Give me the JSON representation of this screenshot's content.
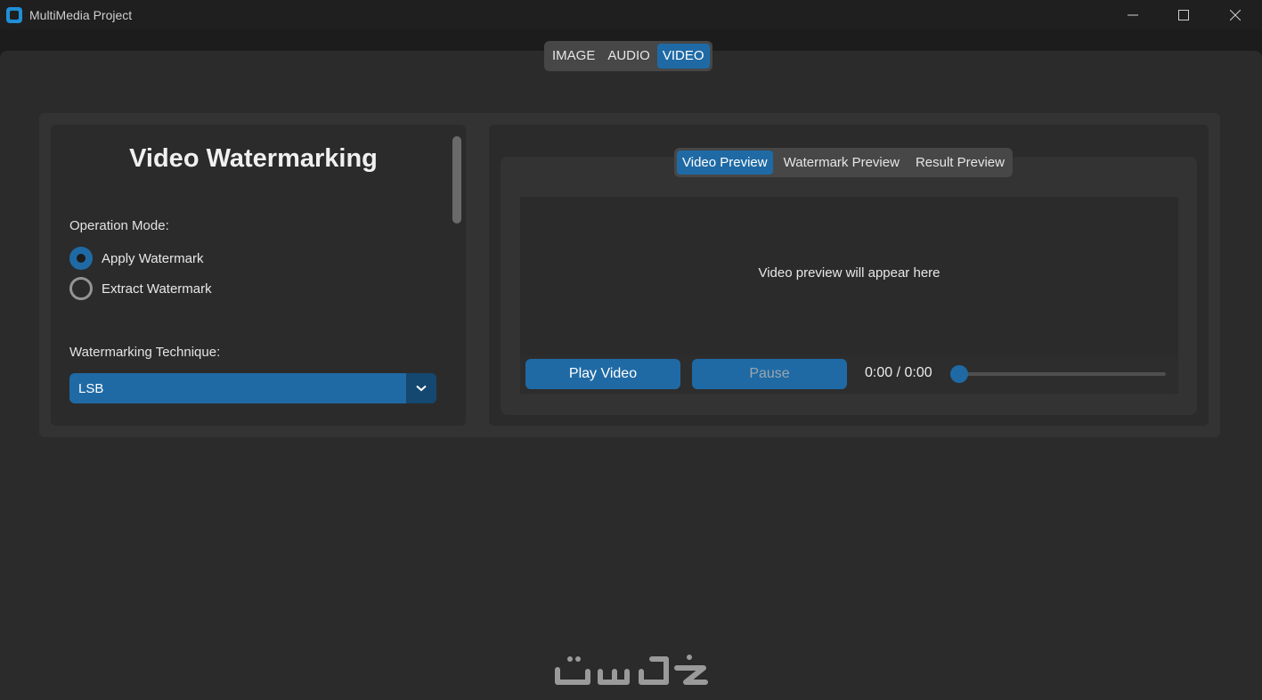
{
  "app": {
    "title": "MultiMedia Project"
  },
  "main_tabs": {
    "items": [
      {
        "label": "IMAGE",
        "active": false
      },
      {
        "label": "AUDIO",
        "active": false
      },
      {
        "label": "VIDEO",
        "active": true
      }
    ]
  },
  "left_panel": {
    "title": "Video Watermarking",
    "operation_mode_label": "Operation Mode:",
    "modes": [
      {
        "label": "Apply Watermark",
        "checked": true
      },
      {
        "label": "Extract Watermark",
        "checked": false
      }
    ],
    "technique_label": "Watermarking Technique:",
    "technique_value": "LSB"
  },
  "preview": {
    "tabs": [
      {
        "label": "Video Preview",
        "active": true
      },
      {
        "label": "Watermark Preview",
        "active": false
      },
      {
        "label": "Result Preview",
        "active": false
      }
    ],
    "placeholder": "Video preview will appear here",
    "play_label": "Play Video",
    "pause_label": "Pause",
    "time": "0:00 / 0:00",
    "progress": 0
  },
  "colors": {
    "accent": "#1f6aa5",
    "accent_dark": "#144870",
    "window_bg": "#2b2b2b",
    "frame_bg": "#333333",
    "titlebar_bg": "#1f1f1f"
  },
  "logo": {
    "text": "خمسات"
  }
}
